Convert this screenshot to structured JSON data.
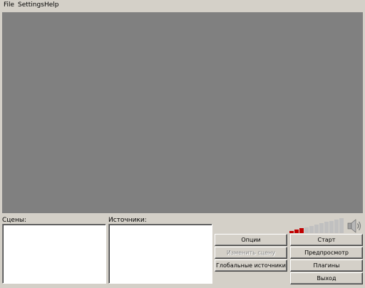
{
  "menu": {
    "file": "File",
    "settings": "Settings",
    "help": "Help"
  },
  "scenes": {
    "label": "Сцены:"
  },
  "sources": {
    "label": "Источники:"
  },
  "buttons": {
    "options": "Опции",
    "edit_scene": "Изменить сцену",
    "global_sources": "Глобальные источники",
    "start": "Старт",
    "preview": "Предпросмотр",
    "plugins": "Плагины",
    "exit": "Выход"
  },
  "audio_meter": {
    "level_fraction": 0.3,
    "active_color": "#c00000",
    "inactive_color": "#c0c0c0"
  },
  "icons": {
    "speaker": "speaker-icon"
  },
  "colors": {
    "preview_bg": "#808080",
    "window_bg": "#d4d0c8"
  }
}
